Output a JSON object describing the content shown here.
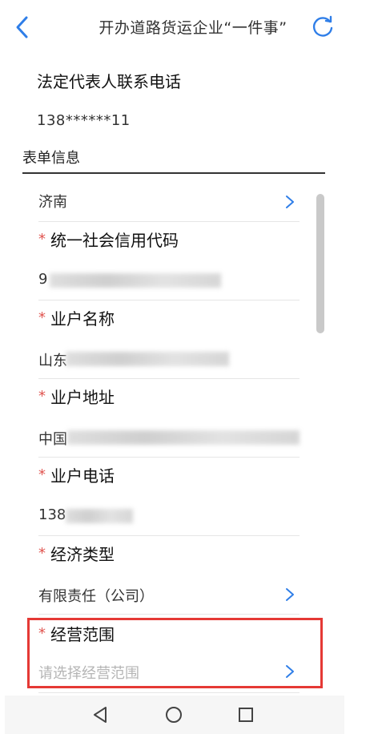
{
  "header": {
    "title": "开办道路货运企业“一件事”"
  },
  "legal_rep_phone": {
    "label": "法定代表人联系电话",
    "value": "138******11"
  },
  "section": {
    "title": "表单信息"
  },
  "form": {
    "city": {
      "value": "济南"
    },
    "credit_code": {
      "label": "统一社会信用代码",
      "value_visible": "9"
    },
    "business_name": {
      "label": "业户名称",
      "value_visible": "山东"
    },
    "business_address": {
      "label": "业户地址",
      "value_visible": "中国"
    },
    "business_phone": {
      "label": "业户电话",
      "value_visible": "138"
    },
    "economic_type": {
      "label": "经济类型",
      "value": "有限责任（公司）"
    },
    "business_scope": {
      "label": "经营范围",
      "placeholder": "请选择经营范围"
    }
  },
  "required_marker": "*",
  "colors": {
    "accent": "#2f7ee8",
    "required": "#e0544f",
    "highlight": "#e53935"
  },
  "icons": {
    "back": "chevron-left-icon",
    "refresh": "refresh-icon",
    "chevron": "chevron-right-icon",
    "nav_back": "triangle-back-icon",
    "nav_home": "circle-home-icon",
    "nav_recent": "square-recent-icon"
  }
}
